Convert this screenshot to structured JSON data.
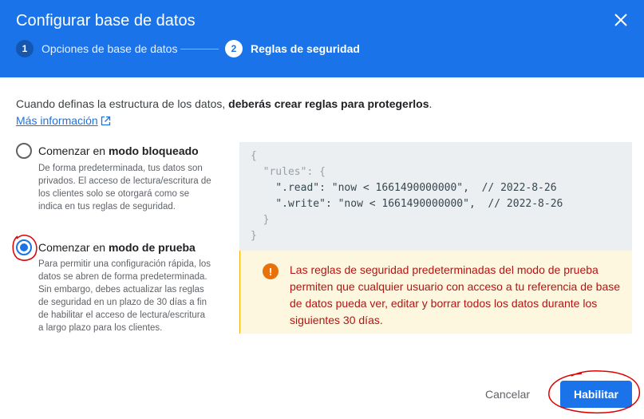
{
  "dialog": {
    "title": "Configurar base de datos",
    "close_icon": "close-icon"
  },
  "stepper": {
    "steps": [
      {
        "number": "1",
        "label": "Opciones de base de datos",
        "state": "completed"
      },
      {
        "number": "2",
        "label": "Reglas de seguridad",
        "state": "active"
      }
    ]
  },
  "intro": {
    "text": "Cuando definas la estructura de los datos, ",
    "bold": "deberás crear reglas para protegerlos",
    "suffix": ".",
    "link": "Más información",
    "link_icon": "open-in-new-icon"
  },
  "options": [
    {
      "prefix": "Comenzar en ",
      "bold": "modo bloqueado",
      "description": "De forma predeterminada, tus datos son privados. El acceso de lectura/escritura de los clientes solo se otorgará como se indica en tus reglas de seguridad.",
      "selected": false
    },
    {
      "prefix": "Comenzar en ",
      "bold": "modo de prueba",
      "description": "Para permitir una configuración rápida, los datos se abren de forma predeterminada. Sin embargo, debes actualizar las reglas de seguridad en un plazo de 30 días a fin de habilitar el acceso de lectura/escritura a largo plazo para los clientes.",
      "selected": true
    }
  ],
  "rules_code": {
    "line1": "{",
    "line2_key": "\"rules\"",
    "line2_rest": ": {",
    "line3_key": "\".read\"",
    "line3_val": ": \"now < 1661490000000\",  // 2022-8-26",
    "line4_key": "\".write\"",
    "line4_val": ": \"now < 1661490000000\",  // 2022-8-26",
    "line5": "}",
    "line6": "}"
  },
  "warning": {
    "icon": "alert-icon",
    "text": "Las reglas de seguridad predeterminadas del modo de prueba permiten que cualquier usuario con acceso a tu referencia de base de datos pueda ver, editar y borrar todos los datos durante los siguientes 30 días."
  },
  "footer": {
    "cancel_label": "Cancelar",
    "enable_label": "Habilitar"
  },
  "colors": {
    "header": "#1a73e8",
    "warning_text": "#b31412",
    "warning_bg": "#fef7e0",
    "annotation": "#e00000"
  }
}
